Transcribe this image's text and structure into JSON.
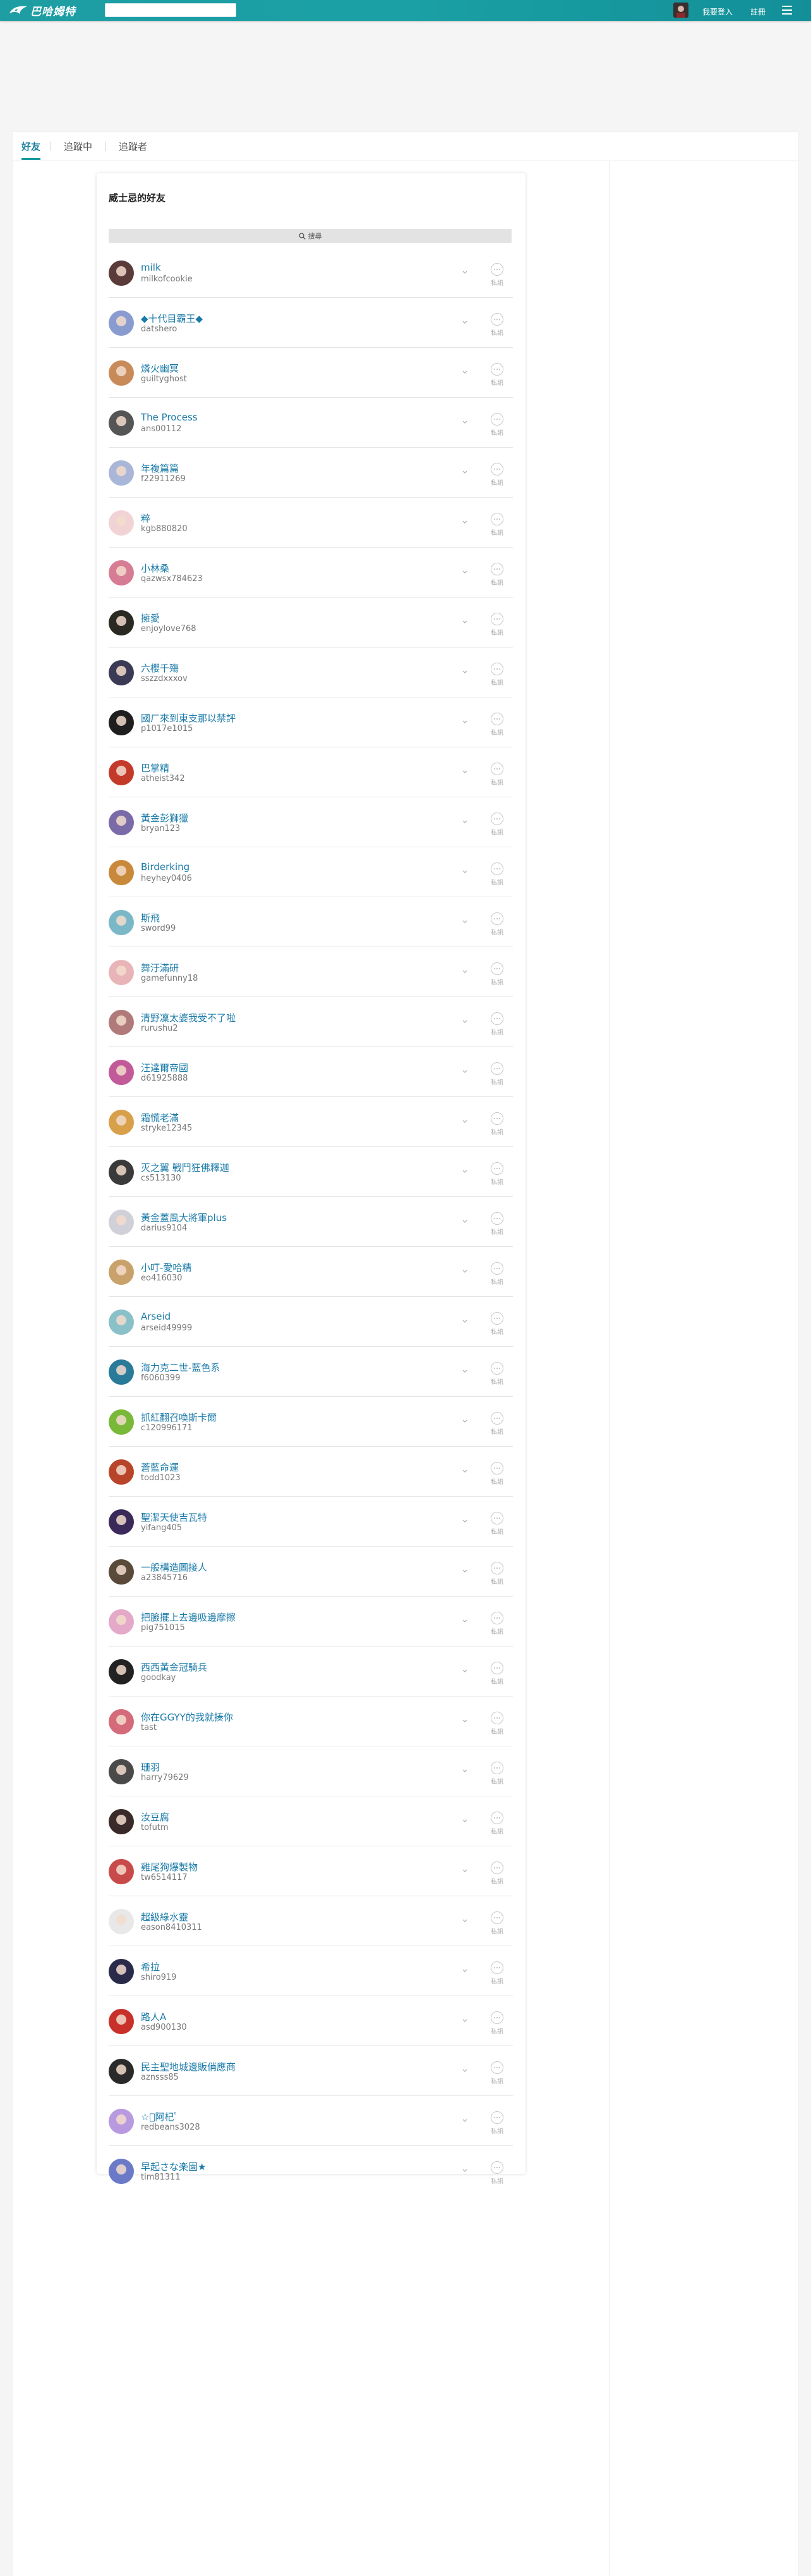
{
  "header": {
    "site_title": "巴哈姆特",
    "search_placeholder": "",
    "login_label": "我要登入",
    "signup_label": "註冊"
  },
  "tabs": [
    {
      "label": "好友",
      "active": true
    },
    {
      "label": "追蹤中",
      "active": false
    },
    {
      "label": "追蹤者",
      "active": false
    }
  ],
  "card": {
    "title": "威士忌的好友",
    "search_label": "搜尋",
    "message_label": "私訊"
  },
  "friends": [
    {
      "name": "milk",
      "id": "milkofcookie",
      "color": "#5b3a3a"
    },
    {
      "name": "◆十代目霸王◆",
      "id": "datshero",
      "color": "#8a9bd0"
    },
    {
      "name": "燐火幽冥",
      "id": "guiltyghost",
      "color": "#c98a5a"
    },
    {
      "name": "The Process",
      "id": "ans00112",
      "color": "#555555"
    },
    {
      "name": "年複篇篇",
      "id": "f22911269",
      "color": "#a9b6d8"
    },
    {
      "name": "粹",
      "id": "kgb880820",
      "color": "#f1d3d6"
    },
    {
      "name": "小林桑",
      "id": "qazwsx784623",
      "color": "#d77c95"
    },
    {
      "name": "擁愛",
      "id": "enjoylove768",
      "color": "#2a2a22"
    },
    {
      "name": "六櫻千殤",
      "id": "sszzdxxxov",
      "color": "#3a3a55"
    },
    {
      "name": "國ㄏ來到東支那以禁評",
      "id": "p1017e1015",
      "color": "#1e1e1e"
    },
    {
      "name": "巴掌精",
      "id": "atheist342",
      "color": "#c43a2a"
    },
    {
      "name": "黃金彭獅獵",
      "id": "bryan123",
      "color": "#7a6aa8"
    },
    {
      "name": "Birderking",
      "id": "heyhey0406",
      "color": "#c9893a"
    },
    {
      "name": "斯飛",
      "id": "sword99",
      "color": "#7ab8c8"
    },
    {
      "name": "舞汙滿研",
      "id": "gamefunny18",
      "color": "#e8b4b8"
    },
    {
      "name": "清野凜太婆我受不了啦",
      "id": "rurushu2",
      "color": "#b07a7a"
    },
    {
      "name": "汪達爾帝國",
      "id": "d61925888",
      "color": "#c25a9a"
    },
    {
      "name": "霜慌老滿",
      "id": "stryke12345",
      "color": "#d8a04a"
    },
    {
      "name": "灭之翼 戰鬥狂佛釋迦",
      "id": "cs513130",
      "color": "#3a3a3a"
    },
    {
      "name": "黃金蓋風大將軍plus",
      "id": "darius9104",
      "color": "#d0d0d8"
    },
    {
      "name": "小叮-愛哈精",
      "id": "eo416030",
      "color": "#c8a26a"
    },
    {
      "name": "Arseid",
      "id": "arseid49999",
      "color": "#8ac0c8"
    },
    {
      "name": "海力克二世-藍色系",
      "id": "f6060399",
      "color": "#2a7a9a"
    },
    {
      "name": "抓紅翻召喚斯卡爾",
      "id": "c120996171",
      "color": "#7ab83a"
    },
    {
      "name": "蒼藍命運",
      "id": "todd1023",
      "color": "#b8452a"
    },
    {
      "name": "聖潔天使吉瓦特",
      "id": "yifang405",
      "color": "#3a2a5a"
    },
    {
      "name": "一般構造圖接人",
      "id": "a23845716",
      "color": "#5a4a3a"
    },
    {
      "name": "把臉擺上去邊吸邊摩擦",
      "id": "pig751015",
      "color": "#e4a8c8"
    },
    {
      "name": "西西黃金冠騎兵",
      "id": "goodkay",
      "color": "#222222"
    },
    {
      "name": "你在GGYY的我就揍你",
      "id": "tast",
      "color": "#d46a7a"
    },
    {
      "name": "珊羽",
      "id": "harry79629",
      "color": "#4a4a4a"
    },
    {
      "name": "汝豆腐",
      "id": "tofutm",
      "color": "#3a2a2a"
    },
    {
      "name": "雞尾狗爆製物",
      "id": "tw6514117",
      "color": "#c84a4a"
    },
    {
      "name": "超級綠水靈",
      "id": "eason8410311",
      "color": "#e8e8e8"
    },
    {
      "name": "希拉",
      "id": "shiro919",
      "color": "#2a2a4a"
    },
    {
      "name": "路人A",
      "id": "asd900130",
      "color": "#c8302a"
    },
    {
      "name": "民主聖地城邊販俏應商",
      "id": "aznsss85",
      "color": "#2a2a2a"
    },
    {
      "name": "☆ﾟ阿杞ﾟ",
      "id": "redbeans3028",
      "color": "#b89ae0"
    },
    {
      "name": "早起さな楽園★",
      "id": "tim81311",
      "color": "#6a7ac8"
    }
  ]
}
